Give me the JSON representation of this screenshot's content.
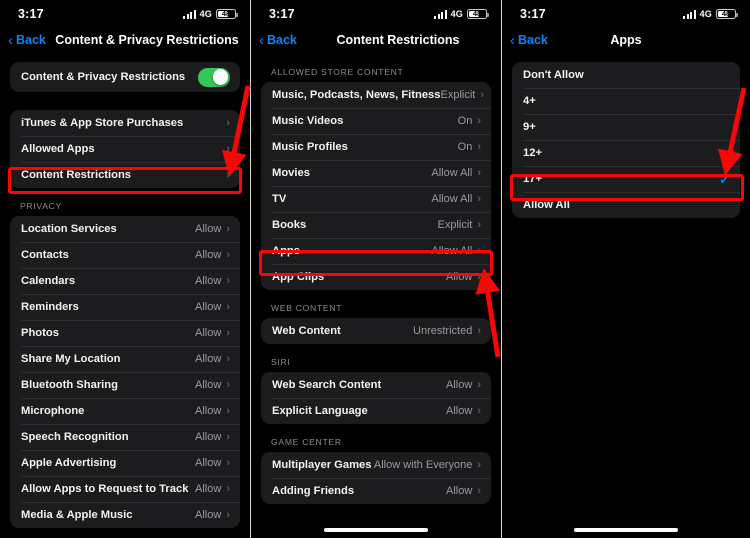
{
  "status": {
    "time": "3:17",
    "network": "4G",
    "battery": "48",
    "signal_bars": 4
  },
  "colors": {
    "accent_blue": "#0a84ff",
    "toggle_green": "#34c759",
    "highlight_red": "#f90606",
    "row_bg": "#1c1c1e",
    "screen_bg": "#000000"
  },
  "panel1": {
    "back_label": "Back",
    "title": "Content & Privacy Restrictions",
    "toggle_row": {
      "label": "Content & Privacy Restrictions",
      "state": "on"
    },
    "group1": [
      {
        "label": "iTunes & App Store Purchases",
        "value": ""
      },
      {
        "label": "Allowed Apps",
        "value": ""
      },
      {
        "label": "Content Restrictions",
        "value": "",
        "highlighted": true
      }
    ],
    "privacy_header": "PRIVACY",
    "group2": [
      {
        "label": "Location Services",
        "value": "Allow"
      },
      {
        "label": "Contacts",
        "value": "Allow"
      },
      {
        "label": "Calendars",
        "value": "Allow"
      },
      {
        "label": "Reminders",
        "value": "Allow"
      },
      {
        "label": "Photos",
        "value": "Allow"
      },
      {
        "label": "Share My Location",
        "value": "Allow"
      },
      {
        "label": "Bluetooth Sharing",
        "value": "Allow"
      },
      {
        "label": "Microphone",
        "value": "Allow"
      },
      {
        "label": "Speech Recognition",
        "value": "Allow"
      },
      {
        "label": "Apple Advertising",
        "value": "Allow"
      },
      {
        "label": "Allow Apps to Request to Track",
        "value": "Allow"
      },
      {
        "label": "Media & Apple Music",
        "value": "Allow"
      }
    ]
  },
  "panel2": {
    "back_label": "Back",
    "title": "Content Restrictions",
    "store_header": "ALLOWED STORE CONTENT",
    "store_rows": [
      {
        "label": "Music, Podcasts, News, Fitness",
        "value": "Explicit"
      },
      {
        "label": "Music Videos",
        "value": "On"
      },
      {
        "label": "Music Profiles",
        "value": "On"
      },
      {
        "label": "Movies",
        "value": "Allow All"
      },
      {
        "label": "TV",
        "value": "Allow All"
      },
      {
        "label": "Books",
        "value": "Explicit"
      },
      {
        "label": "Apps",
        "value": "Allow All",
        "highlighted": true
      },
      {
        "label": "App Clips",
        "value": "Allow"
      }
    ],
    "web_header": "WEB CONTENT",
    "web_rows": [
      {
        "label": "Web Content",
        "value": "Unrestricted"
      }
    ],
    "siri_header": "SIRI",
    "siri_rows": [
      {
        "label": "Web Search Content",
        "value": "Allow"
      },
      {
        "label": "Explicit Language",
        "value": "Allow"
      }
    ],
    "game_header": "GAME CENTER",
    "game_rows": [
      {
        "label": "Multiplayer Games",
        "value": "Allow with Everyone"
      },
      {
        "label": "Adding Friends",
        "value": "Allow"
      }
    ]
  },
  "panel3": {
    "back_label": "Back",
    "title": "Apps",
    "options": [
      {
        "label": "Don't Allow",
        "selected": false
      },
      {
        "label": "4+",
        "selected": false
      },
      {
        "label": "9+",
        "selected": false
      },
      {
        "label": "12+",
        "selected": false
      },
      {
        "label": "17+",
        "selected": true,
        "highlighted": true
      },
      {
        "label": "Allow All",
        "selected": false
      }
    ]
  },
  "icons": {
    "back_chevron": "back-chevron-icon",
    "disclosure_chevron": "chevron-right-icon",
    "checkmark": "checkmark-icon",
    "signal": "cellular-signal-icon",
    "battery": "battery-icon",
    "arrow": "annotation-arrow-icon"
  }
}
